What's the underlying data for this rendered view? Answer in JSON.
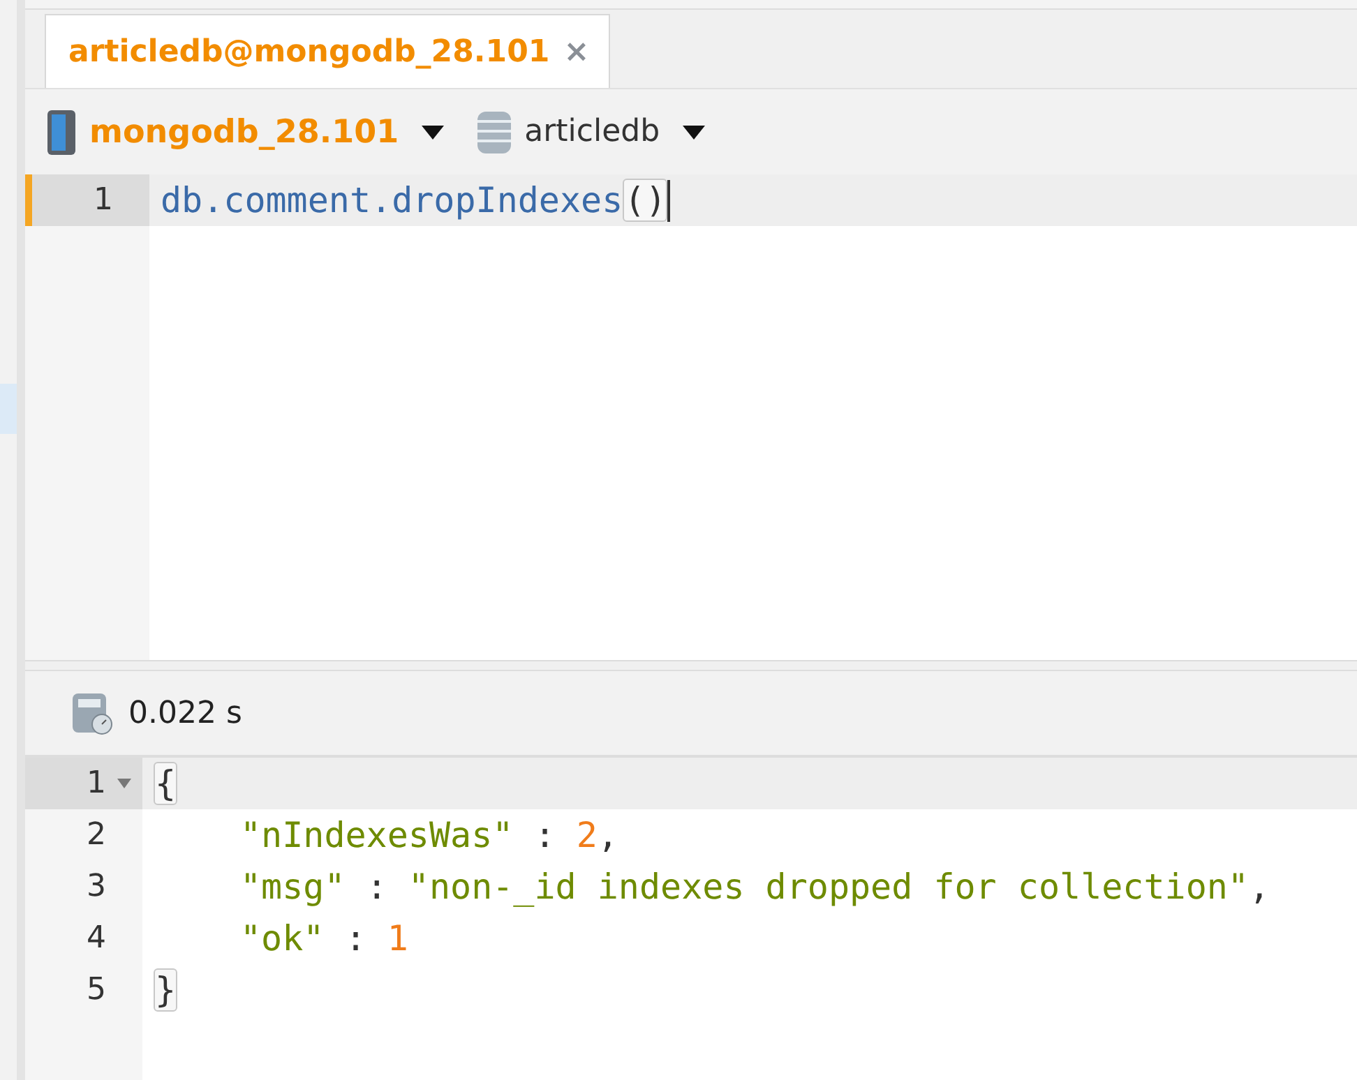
{
  "tab": {
    "title": "articledb@mongodb_28.101",
    "close": "×",
    "selected": true
  },
  "toolbar": {
    "connection": "mongodb_28.101",
    "database": "articledb"
  },
  "editor": {
    "lines": [
      {
        "number": "1",
        "current": true,
        "tokens": [
          {
            "kind": "code",
            "text": "db.comment.dropIndexes"
          },
          {
            "kind": "bracket",
            "text": "()"
          }
        ]
      }
    ]
  },
  "result": {
    "time": "0.022 s",
    "lines": [
      {
        "number": "1",
        "current": true,
        "fold": true,
        "tokens": [
          {
            "kind": "bracket",
            "text": "{"
          }
        ]
      },
      {
        "number": "2",
        "current": false,
        "fold": false,
        "indent": true,
        "tokens": [
          {
            "kind": "string",
            "text": "\"nIndexesWas\""
          },
          {
            "kind": "punct",
            "text": " : "
          },
          {
            "kind": "number",
            "text": "2"
          },
          {
            "kind": "punct",
            "text": ","
          }
        ]
      },
      {
        "number": "3",
        "current": false,
        "fold": false,
        "indent": true,
        "tokens": [
          {
            "kind": "string",
            "text": "\"msg\""
          },
          {
            "kind": "punct",
            "text": " : "
          },
          {
            "kind": "string",
            "text": "\"non-_id indexes dropped for collection\""
          },
          {
            "kind": "punct",
            "text": ","
          }
        ]
      },
      {
        "number": "4",
        "current": false,
        "fold": false,
        "indent": true,
        "tokens": [
          {
            "kind": "string",
            "text": "\"ok\""
          },
          {
            "kind": "punct",
            "text": " : "
          },
          {
            "kind": "number",
            "text": "1"
          }
        ]
      },
      {
        "number": "5",
        "current": false,
        "fold": false,
        "tokens": [
          {
            "kind": "bracket",
            "text": "}"
          }
        ]
      }
    ]
  }
}
